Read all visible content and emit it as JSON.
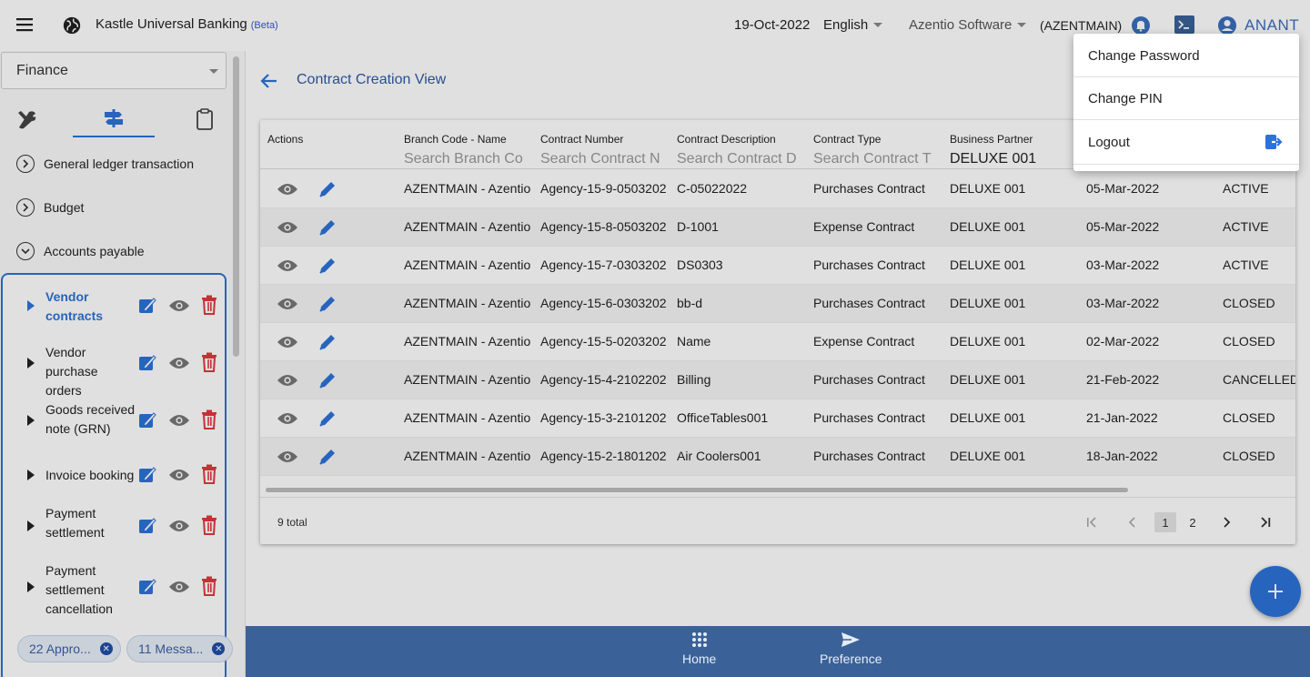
{
  "app": {
    "name": "Kastle Universal Banking",
    "beta": "(Beta)",
    "date": "19-Oct-2022",
    "language": "English",
    "company": "Azentio Software",
    "branch": "(AZENTMAIN)",
    "user": "ANANT"
  },
  "sidebar": {
    "module": "Finance",
    "menu": [
      {
        "label": "General ledger transaction"
      },
      {
        "label": "Budget"
      },
      {
        "label": "Accounts payable"
      }
    ],
    "sub_items": [
      {
        "label": "Vendor contracts"
      },
      {
        "label": "Vendor purchase orders"
      },
      {
        "label": "Goods received note (GRN)"
      },
      {
        "label": "Invoice booking"
      },
      {
        "label": "Payment settlement"
      },
      {
        "label": "Payment settlement cancellation"
      }
    ],
    "chips": [
      {
        "label": "22 Appro..."
      },
      {
        "label": "11 Messa..."
      }
    ]
  },
  "main": {
    "title": "Contract Creation View",
    "columns": [
      {
        "header": "Actions",
        "search": ""
      },
      {
        "header": "Branch Code - Name",
        "search": "Search Branch Co"
      },
      {
        "header": "Contract Number",
        "search": "Search Contract N"
      },
      {
        "header": "Contract Description",
        "search": "Search Contract D"
      },
      {
        "header": "Contract Type",
        "search": "Search Contract T"
      },
      {
        "header": "Business Partner",
        "search": "DELUXE 001"
      }
    ],
    "rows": [
      {
        "branch": "AZENTMAIN - Azentio M",
        "number": "Agency-15-9-0503202",
        "desc": "C-05022022",
        "type": "Purchases Contract",
        "partner": "DELUXE 001",
        "date": "05-Mar-2022",
        "status": "ACTIVE"
      },
      {
        "branch": "AZENTMAIN - Azentio M",
        "number": "Agency-15-8-0503202",
        "desc": "D-1001",
        "type": "Expense Contract",
        "partner": "DELUXE 001",
        "date": "05-Mar-2022",
        "status": "ACTIVE"
      },
      {
        "branch": "AZENTMAIN - Azentio M",
        "number": "Agency-15-7-0303202",
        "desc": "DS0303",
        "type": "Purchases Contract",
        "partner": "DELUXE 001",
        "date": "03-Mar-2022",
        "status": "ACTIVE"
      },
      {
        "branch": "AZENTMAIN - Azentio M",
        "number": "Agency-15-6-0303202",
        "desc": "bb-d",
        "type": "Purchases Contract",
        "partner": "DELUXE 001",
        "date": "03-Mar-2022",
        "status": "CLOSED"
      },
      {
        "branch": "AZENTMAIN - Azentio M",
        "number": "Agency-15-5-0203202",
        "desc": "Name",
        "type": "Expense Contract",
        "partner": "DELUXE 001",
        "date": "02-Mar-2022",
        "status": "CLOSED"
      },
      {
        "branch": "AZENTMAIN - Azentio M",
        "number": "Agency-15-4-2102202",
        "desc": "Billing",
        "type": "Purchases Contract",
        "partner": "DELUXE 001",
        "date": "21-Feb-2022",
        "status": "CANCELLED"
      },
      {
        "branch": "AZENTMAIN - Azentio M",
        "number": "Agency-15-3-2101202",
        "desc": "OfficeTables001",
        "type": "Purchases Contract",
        "partner": "DELUXE 001",
        "date": "21-Jan-2022",
        "status": "CLOSED"
      },
      {
        "branch": "AZENTMAIN - Azentio M",
        "number": "Agency-15-2-1801202",
        "desc": "Air Coolers001",
        "type": "Purchases Contract",
        "partner": "DELUXE 001",
        "date": "18-Jan-2022",
        "status": "CLOSED"
      }
    ],
    "total": "9 total",
    "pages": [
      "1",
      "2"
    ]
  },
  "bottom_nav": {
    "home": "Home",
    "preference": "Preference"
  },
  "user_menu": {
    "change_password": "Change Password",
    "change_pin": "Change PIN",
    "logout": "Logout"
  },
  "colors": {
    "accent": "#2d72d9",
    "delete": "#e0393e",
    "bottom_nav": "#3a6298"
  },
  "icons": [
    "menu-icon",
    "globe-icon",
    "bell-icon",
    "terminal-icon",
    "user-icon",
    "tools-icon",
    "signpost-icon",
    "clipboard-icon",
    "eye-icon",
    "pencil-icon",
    "edit-icon",
    "trash-icon",
    "plus-icon",
    "grid-icon",
    "send-icon",
    "logout-icon"
  ]
}
